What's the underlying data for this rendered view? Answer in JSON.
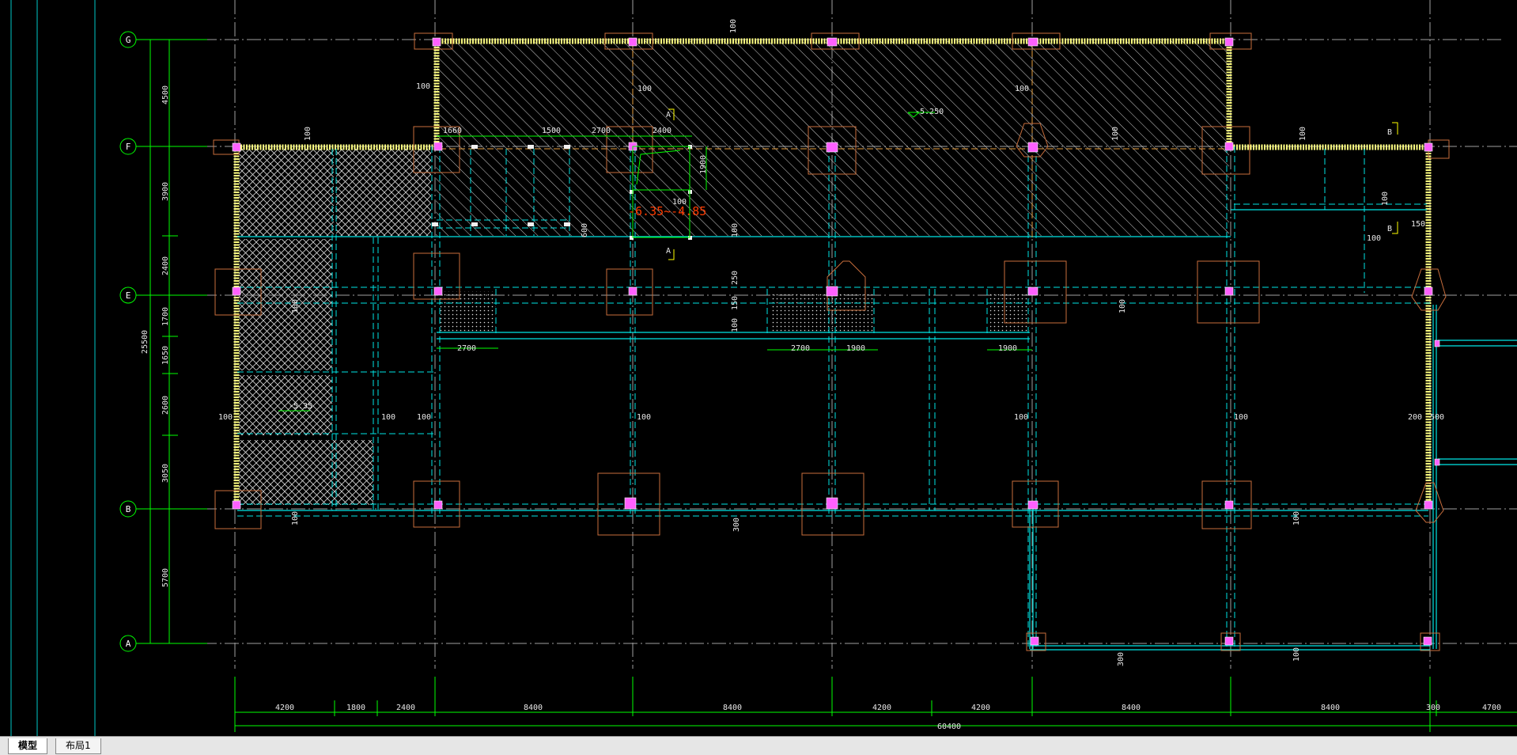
{
  "tabs": {
    "model": "模型",
    "layout1": "布局1"
  },
  "grid_rows": [
    {
      "label": "G"
    },
    {
      "label": "F"
    },
    {
      "label": "E"
    },
    {
      "label": "B"
    },
    {
      "label": "A"
    }
  ],
  "left_dims": [
    "4500",
    "3900",
    "2400",
    "1700",
    "1650",
    "2600",
    "3050",
    "5700"
  ],
  "left_total": "25500",
  "bottom_dims": [
    "4200",
    "1800",
    "2400",
    "8400",
    "8400",
    "4200",
    "4200",
    "8400",
    "8400",
    "300",
    "4700"
  ],
  "bottom_total": "60400",
  "annotations": {
    "elev_roof": "-5.250",
    "elev_left": "-5.35",
    "elev_red": "-6.35~-4.85",
    "section_a": "A",
    "section_b": "B"
  },
  "small_dims": {
    "d100": "100",
    "d150": "150",
    "d200": "200",
    "d250": "250",
    "d300": "300",
    "d500": "500",
    "d600": "600",
    "d1500": "1500",
    "d1660": "1660",
    "d1900": "1900",
    "d2400": "2400",
    "d2700": "2700"
  },
  "colors": {
    "background": "#000000",
    "grid_line": "#00ff00",
    "wall": "#ffff80",
    "beam": "#00e5e5",
    "pile": "#c86e3c",
    "column": "#ff40ff",
    "text_red": "#ff3c00"
  }
}
